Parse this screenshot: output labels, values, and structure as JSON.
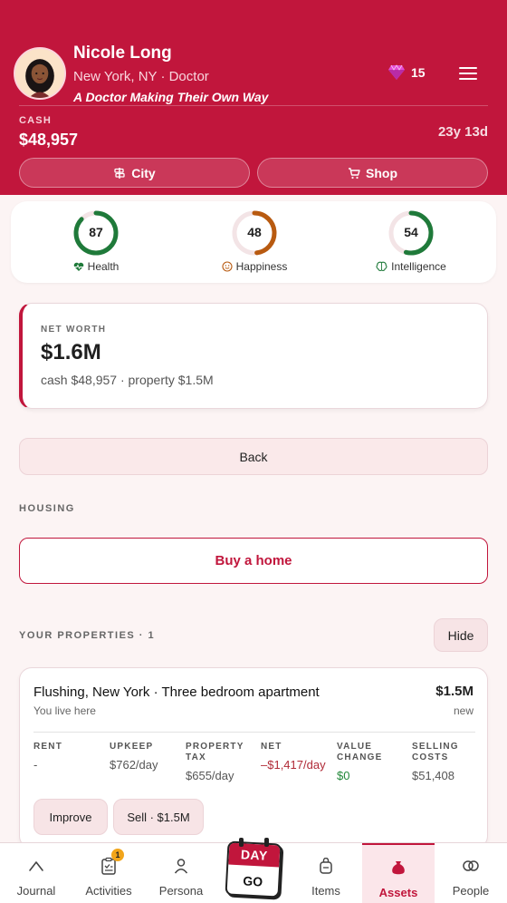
{
  "header": {
    "name": "Nicole Long",
    "subline": "New York, NY · Doctor",
    "tagline": "A Doctor Making Their Own Way",
    "gems": "15",
    "cash_label": "CASH",
    "cash_value": "$48,957",
    "age": "23y 13d",
    "city_button": "City",
    "shop_button": "Shop",
    "accent": "#c1163c"
  },
  "stats": [
    {
      "value": "87",
      "label": "Health",
      "percent": 87,
      "color": "#1f7a3a",
      "icon": "heart-pulse-icon"
    },
    {
      "value": "48",
      "label": "Happiness",
      "percent": 48,
      "color": "#b85a10",
      "icon": "smiley-icon"
    },
    {
      "value": "54",
      "label": "Intelligence",
      "percent": 54,
      "color": "#1f7a3a",
      "icon": "brain-icon"
    }
  ],
  "networth": {
    "label": "NET WORTH",
    "value": "$1.6M",
    "breakdown": "cash $48,957 · property $1.5M"
  },
  "back_button": "Back",
  "housing_label": "HOUSING",
  "buy_home_button": "Buy a home",
  "properties_label": "YOUR PROPERTIES · 1",
  "hide_button": "Hide",
  "property": {
    "title": "Flushing, New York · Three bedroom apartment",
    "subtitle": "You live here",
    "price": "$1.5M",
    "condition": "new",
    "columns": [
      {
        "header": "RENT",
        "value": "-"
      },
      {
        "header": "UPKEEP",
        "value": "$762/day"
      },
      {
        "header": "PROPERTY TAX",
        "value": "$655/day"
      },
      {
        "header": "NET",
        "value": "–$1,417/day"
      },
      {
        "header": "VALUE CHANGE",
        "value": "$0"
      },
      {
        "header": "SELLING COSTS",
        "value": "$51,408"
      }
    ],
    "improve_button": "Improve",
    "sell_button": "Sell · $1.5M"
  },
  "nav": {
    "journal": "Journal",
    "activities": "Activities",
    "activities_badge": "1",
    "persona": "Persona",
    "day_top": "DAY",
    "day_bottom": "GO",
    "items": "Items",
    "assets": "Assets",
    "people": "People"
  }
}
